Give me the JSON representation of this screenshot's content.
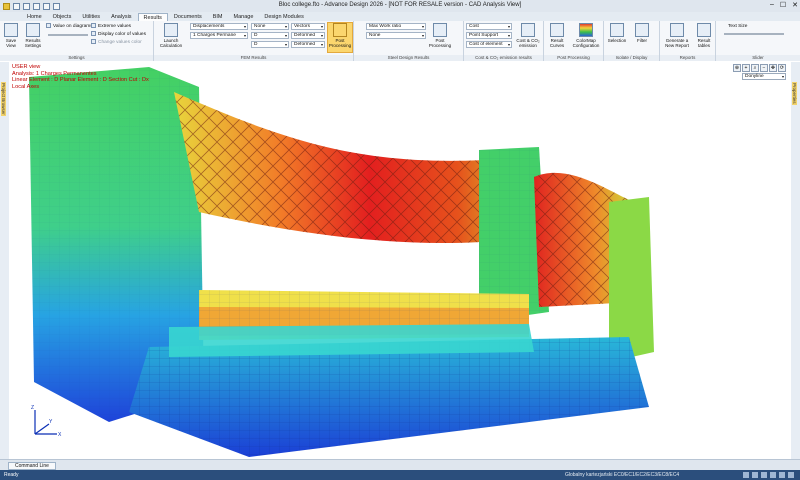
{
  "window": {
    "title": "Bloc college.fto - Advance Design 2026 - [NOT FOR RESALE version - CAD Analysis View]"
  },
  "app_button": "▾",
  "tabs": [
    "Home",
    "Objects",
    "Utilities",
    "Analysis",
    "Results",
    "Documents",
    "BIM",
    "Manage",
    "Design Modules"
  ],
  "active_tab": "Results",
  "ribbon": {
    "settings": {
      "save_view": "Save View",
      "results_settings": "Results Settings",
      "value_on_diagrams": "Value on diagrams",
      "extreme_values": "Extreme values",
      "display_color_of_values": "Display color of values",
      "change_values_color": "Change values color",
      "label": "Settings"
    },
    "fem": {
      "launch_calculation": "Launch Calculation",
      "displacements": "Displacements",
      "case": "1 Charges Permane",
      "d1": "D",
      "d2": "D",
      "none": "None",
      "vectors": "Vectors",
      "deformed1": "Deformed",
      "deformed2": "Deformed",
      "post_processing": "Post Processing",
      "label": "FEM Results"
    },
    "steel": {
      "max_work_ratio": "Max Work ratio",
      "none": "None",
      "post_processing": "Post Processing",
      "label": "Steel Design Results"
    },
    "cost": {
      "cost": "Cost",
      "point_support": "Point Support",
      "cost_of_element": "Cost of element",
      "cost_co2_emission": "Cost & CO₂ emission",
      "label": "Cost & CO₂ emission results"
    },
    "post": {
      "result_curves": "Result Curves",
      "colormap_configuration": "ColorMap Configuration",
      "label": "Post Processing"
    },
    "isolate": {
      "selection": "Selection",
      "filter": "Filter",
      "label": "Isolate / Display"
    },
    "reports": {
      "generate_report": "Generate a New Report",
      "result_tables": "Result tables",
      "label": "Reports"
    },
    "slider": {
      "text_size": "Text Size",
      "label": "Slider"
    }
  },
  "left_panel": "Project Browser",
  "right_panel": "Properties",
  "viewport": {
    "info": [
      "USER view",
      "Analysis: 1 Charges Permanentes",
      "Linear Element : D Planar Element : D Section Cut : Dx",
      "Local Axes"
    ],
    "display_mode": "Donyline",
    "axes": {
      "x": "X",
      "y": "Y",
      "z": "Z"
    }
  },
  "command_line": "Command Line",
  "status": {
    "ready": "Ready",
    "right": "Globalny kartezjański  EC0/EC1/EC2/EC3/EC8/EC4"
  },
  "colors": {
    "ribbon_bg": "#f5f7fa",
    "status_bg": "#2b4e7c",
    "info_text": "#c00000",
    "highlight": "#fbd66e"
  }
}
